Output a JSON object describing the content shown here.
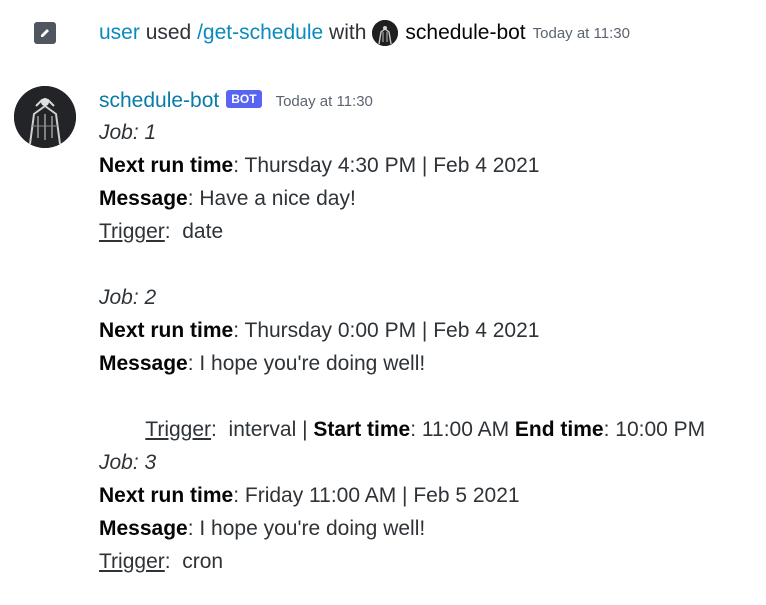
{
  "command": {
    "user": "user",
    "used_word": "used",
    "command_name": "/get-schedule",
    "with_word": "with",
    "bot_name": "schedule-bot",
    "timestamp": "Today at 11:30"
  },
  "message": {
    "author": "schedule-bot",
    "bot_tag": "BOT",
    "timestamp": "Today at 11:30",
    "labels": {
      "next_run": "Next run time",
      "message": "Message",
      "trigger": "Trigger",
      "start_time": "Start time",
      "end_time": "End time"
    },
    "jobs": [
      {
        "title": "Job: 1",
        "next_run": ": Thursday 4:30 PM | Feb 4 2021",
        "message": ": Have a nice day!",
        "trigger": ":  date"
      },
      {
        "title": "Job: 2",
        "next_run": ": Thursday 0:00 PM | Feb 4 2021",
        "message": ": I hope you're doing well!",
        "trigger": ":  interval | ",
        "start_time": ": 11:00 AM ",
        "end_time": ": 10:00 PM"
      },
      {
        "title": "Job: 3",
        "next_run": ": Friday 11:00 AM | Feb 5 2021",
        "message": ": I hope you're doing well!",
        "trigger": ":  cron"
      }
    ]
  },
  "colors": {
    "link": "#0a8ac0",
    "username": "#0a7ca6",
    "bot_tag": "#5865f2",
    "text": "#2e3338"
  }
}
